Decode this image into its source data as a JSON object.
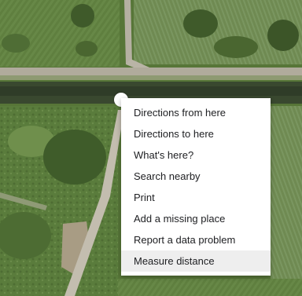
{
  "map": {
    "view": "satellite",
    "pin_color": "#ffffff"
  },
  "context_menu": {
    "items": [
      {
        "label": "Directions from here"
      },
      {
        "label": "Directions to here"
      },
      {
        "label": "What's here?"
      },
      {
        "label": "Search nearby"
      },
      {
        "label": "Print"
      },
      {
        "label": "Add a missing place"
      },
      {
        "label": "Report a data problem"
      },
      {
        "label": "Measure distance",
        "highlighted": true
      }
    ]
  }
}
